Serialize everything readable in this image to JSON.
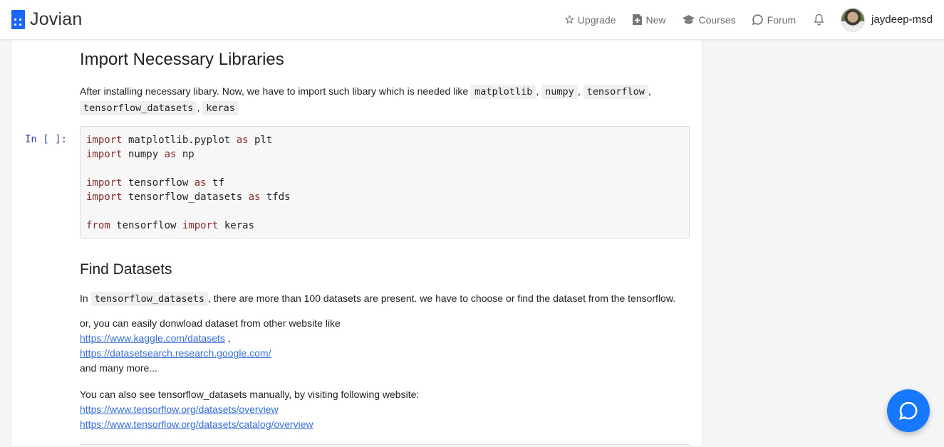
{
  "app": {
    "name": "Jovian",
    "brand_color": "#1a66ff"
  },
  "nav": {
    "upgrade": "Upgrade",
    "new": "New",
    "courses": "Courses",
    "forum": "Forum",
    "username": "jaydeep-msd"
  },
  "section1": {
    "heading": "Import Necessary Libraries",
    "intro": "After installing necessary libary. Now, we have to import such libary which is needed like",
    "libs": [
      "matplotlib",
      "numpy",
      "tensorflow",
      "tensorflow_datasets",
      "keras"
    ]
  },
  "cell1": {
    "prompt": "In [ ]:",
    "lines": [
      {
        "kw": "import",
        "mid": " matplotlib.pyplot ",
        "kw2": "as",
        "tail": " plt"
      },
      {
        "kw": "import",
        "mid": " numpy ",
        "kw2": "as",
        "tail": " np"
      },
      {
        "kw": "import",
        "mid": " tensorflow ",
        "kw2": "as",
        "tail": " tf"
      },
      {
        "kw": "import",
        "mid": " tensorflow_datasets ",
        "kw2": "as",
        "tail": " tfds"
      },
      {
        "kw": "from",
        "mid": " tensorflow ",
        "kw2": "import",
        "tail": " keras"
      }
    ]
  },
  "section2": {
    "heading": "Find Datasets",
    "p1_pre": "In",
    "p1_code": "tensorflow_datasets",
    "p1_post": ", there are more than 100 datasets are present. we have to choose or find the dataset from the tensorflow.",
    "p2_line1": "or, you can easily donwload dataset from other website like",
    "link1": "https://www.kaggle.com/datasets",
    "link1_suffix": " ,",
    "link2": "https://datasetsearch.research.google.com/",
    "p2_end": "and many more...",
    "p3_line1": "You can also see tensorflow_datasets manually, by visiting following website:",
    "link3": "https://www.tensorflow.org/datasets/overview",
    "link4": "https://www.tensorflow.org/datasets/catalog/overview"
  }
}
